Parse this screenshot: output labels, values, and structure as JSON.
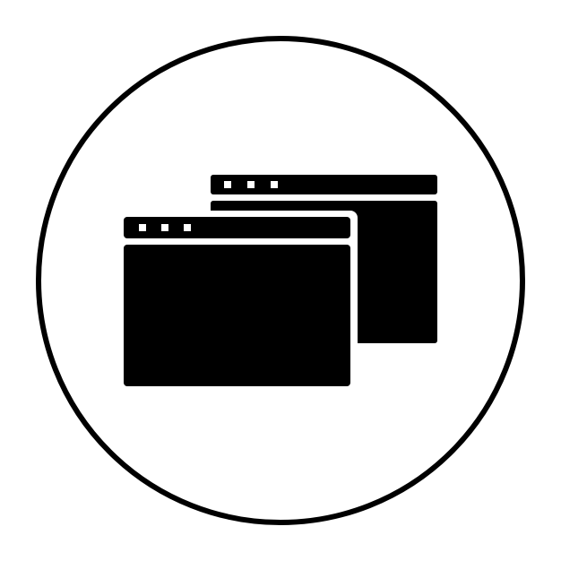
{
  "icon": {
    "name": "multiple-windows-icon",
    "colors": {
      "background": "#ffffff",
      "foreground": "#000000"
    }
  }
}
